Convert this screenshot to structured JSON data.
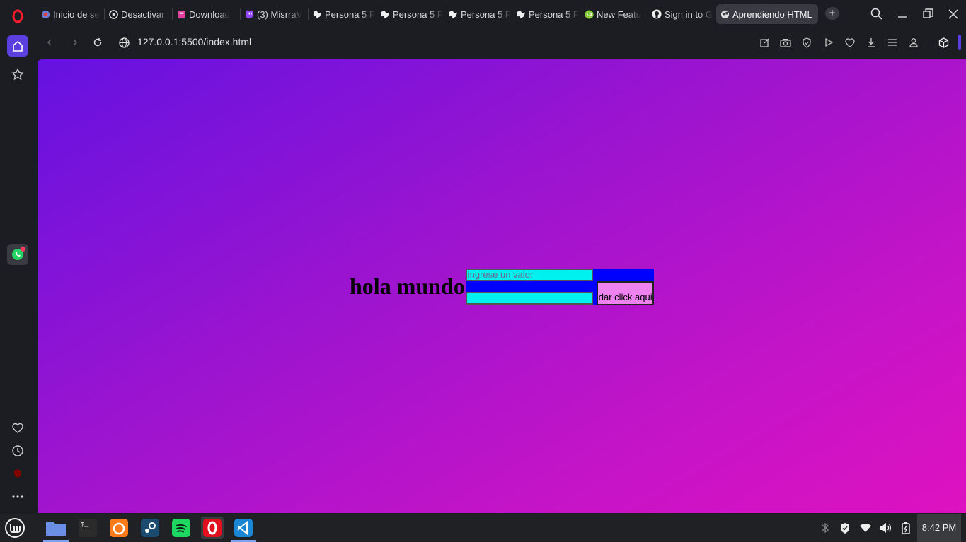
{
  "browser": {
    "tabs": [
      {
        "title": "Inicio de se",
        "favicon": "globe-icon"
      },
      {
        "title": "Desactivar l",
        "favicon": "chatgpt-icon"
      },
      {
        "title": "Download",
        "favicon": "download-site-icon"
      },
      {
        "title": "(3) MisrraV",
        "favicon": "twitch-icon"
      },
      {
        "title": "Persona 5 F",
        "favicon": "persona-icon"
      },
      {
        "title": "Persona 5 F",
        "favicon": "persona-icon"
      },
      {
        "title": "Persona 5 F",
        "favicon": "persona-icon"
      },
      {
        "title": "Persona 5 F",
        "favicon": "persona-icon"
      },
      {
        "title": "New Featu",
        "favicon": "mint-icon"
      },
      {
        "title": "Sign in to G",
        "favicon": "github-icon"
      },
      {
        "title": "Aprendiendo HTML",
        "favicon": "globe-icon"
      }
    ],
    "address": "127.0.0.1:5500/index.html"
  },
  "page": {
    "heading": "hola mundo",
    "input1_placeholder": "ingrese un valor",
    "input2_value": "",
    "button_label": "dar click aqui"
  },
  "taskbar": {
    "apps": [
      "files",
      "terminal",
      "firefox",
      "steam",
      "spotify",
      "opera",
      "vscode"
    ],
    "clock": "8:42 PM"
  },
  "colors": {
    "gradient_start": "#6512e1",
    "gradient_end": "#de12c0",
    "form_bg": "#0000ff",
    "input_bg": "#00f0f0",
    "button_bg": "#ee82ee"
  }
}
